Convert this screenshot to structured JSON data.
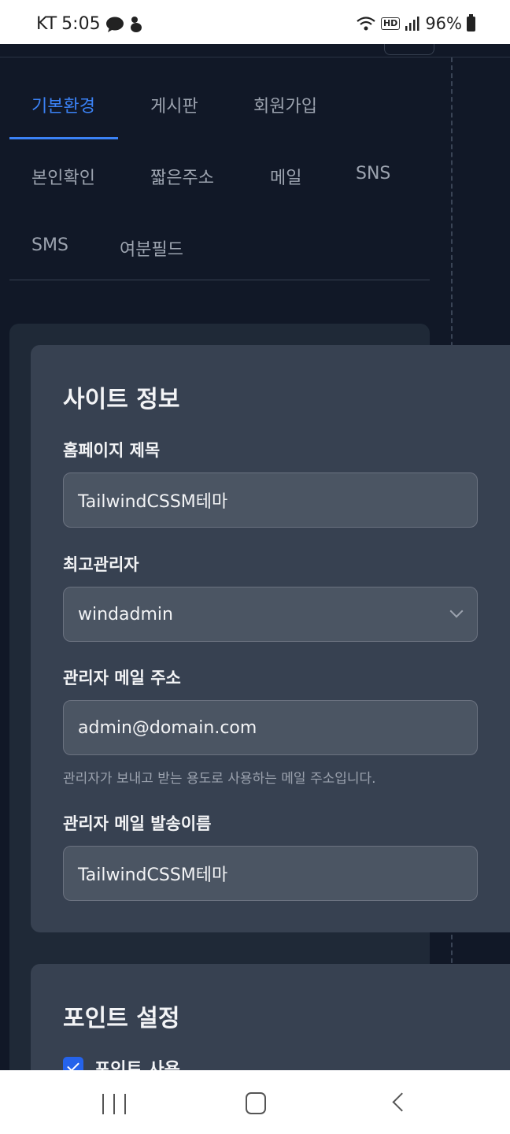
{
  "status_bar": {
    "carrier": "KT",
    "time": "5:05",
    "battery": "96%",
    "icons": [
      "chat-bubble-icon",
      "pet-icon",
      "wifi-icon",
      "hd-icon",
      "signal-icon",
      "battery-icon"
    ]
  },
  "tabs": [
    {
      "label": "기본환경",
      "active": true
    },
    {
      "label": "게시판"
    },
    {
      "label": "회원가입"
    },
    {
      "label": "본인확인"
    },
    {
      "label": "짧은주소"
    },
    {
      "label": "메일"
    },
    {
      "label": "SNS"
    },
    {
      "label": "SMS"
    },
    {
      "label": "여분필드"
    }
  ],
  "site_info": {
    "title": "사이트 정보",
    "homepage_title_label": "홈페이지 제목",
    "homepage_title_value": "TailwindCSSM테마",
    "super_admin_label": "최고관리자",
    "super_admin_value": "windadmin",
    "admin_email_label": "관리자 메일 주소",
    "admin_email_value": "admin@domain.com",
    "admin_email_help": "관리자가 보내고 받는 용도로 사용하는 메일 주소입니다.",
    "admin_sender_label": "관리자 메일 발송이름",
    "admin_sender_value": "TailwindCSSM테마"
  },
  "point_settings": {
    "title": "포인트 설정",
    "use_points_label": "포인트 사용",
    "use_points_checked": true
  },
  "colors": {
    "accent": "#3b82f6",
    "background": "#111827",
    "card": "#374151",
    "input": "#4b5563"
  }
}
